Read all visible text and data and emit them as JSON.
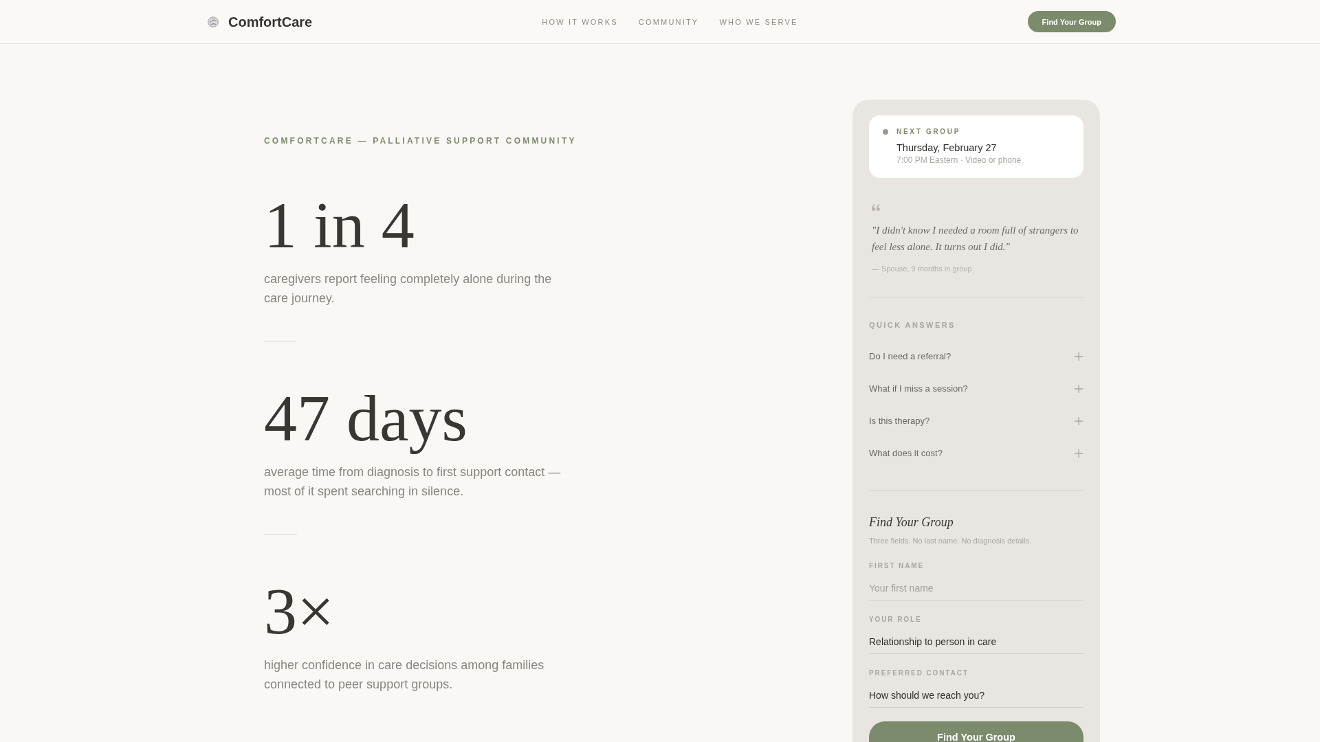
{
  "header": {
    "logo": "ComfortCare",
    "nav": [
      "HOW IT WORKS",
      "COMMUNITY",
      "WHO WE SERVE"
    ],
    "cta": "Find Your Group"
  },
  "hero": {
    "eyebrow": "COMFORTCARE — PALLIATIVE SUPPORT COMMUNITY",
    "stats": [
      {
        "figure": "1 in 4",
        "description": "caregivers report feeling completely alone during the care journey."
      },
      {
        "figure": "47 days",
        "description": "average time from diagnosis to first support contact — most of it spent searching in silence."
      },
      {
        "figure": "3×",
        "description": "higher confidence in care decisions among families connected to peer support groups."
      }
    ]
  },
  "sidebar": {
    "next_group": {
      "label": "NEXT GROUP",
      "date": "Thursday, February 27",
      "details": "7:00 PM Eastern · Video or phone"
    },
    "testimonial": {
      "quote": "\"I didn't know I needed a room full of strangers to feel less alone. It turns out I did.\"",
      "attribution": "— Spouse, 9 months in group"
    },
    "quick_answers": {
      "heading": "QUICK ANSWERS",
      "items": [
        {
          "question": "Do I need a referral?",
          "expanded": false
        },
        {
          "question": "What if I miss a session?",
          "expanded": false
        },
        {
          "question": "Is this therapy?",
          "expanded": false
        },
        {
          "question": "What does it cost?",
          "expanded": false
        }
      ]
    },
    "form": {
      "title": "Find Your Group",
      "subtitle": "Three fields. No last name. No diagnosis details.",
      "fields": [
        {
          "kind": "text",
          "label": "FIRST NAME",
          "placeholder": "Your first name"
        },
        {
          "kind": "select",
          "label": "YOUR ROLE",
          "value": "Relationship to person in care"
        },
        {
          "kind": "select",
          "label": "PREFERRED CONTACT",
          "value": "How should we reach you?"
        }
      ],
      "submit": "Find Your Group"
    }
  }
}
